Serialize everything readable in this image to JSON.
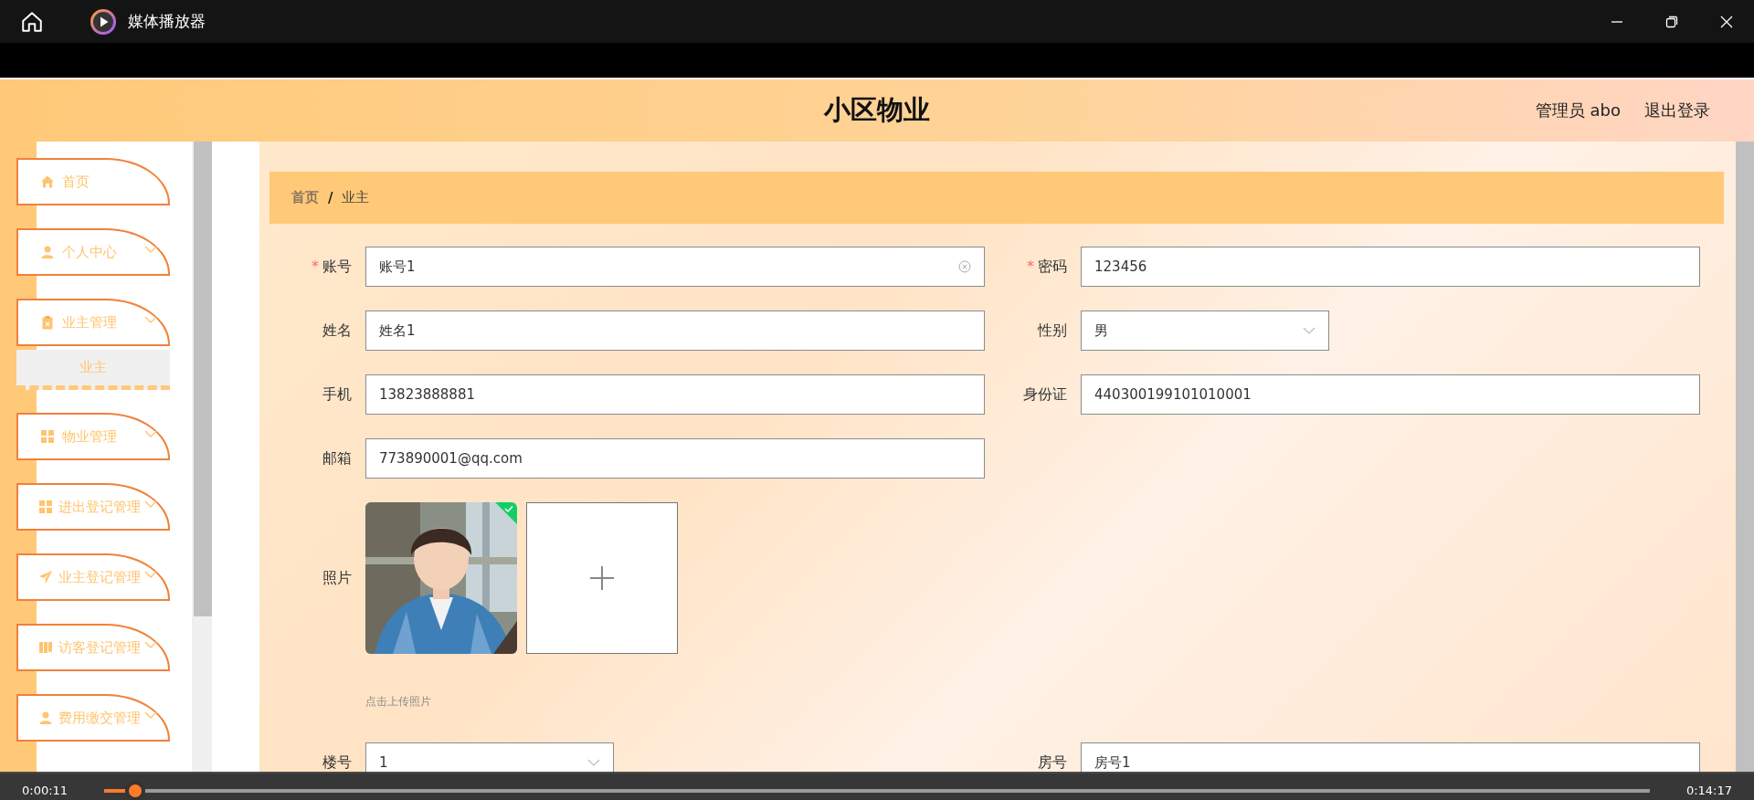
{
  "window": {
    "title": "媒体播放器"
  },
  "app": {
    "title": "小区物业",
    "user": "管理员 abo",
    "logout": "退出登录",
    "sidebar": [
      {
        "label": "首页",
        "has_submenu": false
      },
      {
        "label": "个人中心",
        "has_submenu": true
      },
      {
        "label": "业主管理",
        "has_submenu": true,
        "children": [
          {
            "label": "业主",
            "selected": true
          }
        ]
      },
      {
        "label": "物业管理",
        "has_submenu": true
      },
      {
        "label": "进出登记管理",
        "has_submenu": true
      },
      {
        "label": "业主登记管理",
        "has_submenu": true
      },
      {
        "label": "访客登记管理",
        "has_submenu": true
      },
      {
        "label": "费用缴交管理",
        "has_submenu": true
      }
    ],
    "breadcrumb": {
      "items": [
        "首页",
        "业主"
      ],
      "separator": "/"
    },
    "form": {
      "required_mark": "*",
      "rows": [
        [
          {
            "label": "账号",
            "required": true,
            "kind": "text",
            "value": "账号1",
            "focused": true
          },
          {
            "label": "密码",
            "required": true,
            "kind": "text",
            "value": "123456",
            "focused": false
          }
        ],
        [
          {
            "label": "姓名",
            "required": false,
            "kind": "text",
            "value": "姓名1",
            "focused": false
          },
          {
            "label": "性别",
            "required": false,
            "kind": "select",
            "value": "男"
          }
        ],
        [
          {
            "label": "手机",
            "required": false,
            "kind": "text",
            "value": "13823888881",
            "focused": false
          },
          {
            "label": "身份证",
            "required": false,
            "kind": "text",
            "value": "440300199101010001",
            "focused": false
          }
        ],
        [
          {
            "label": "邮箱",
            "required": false,
            "kind": "text",
            "value": "773890001@qq.com",
            "focused": false
          }
        ],
        [
          {
            "label": "照片",
            "required": false,
            "kind": "upload",
            "uploaded": true,
            "hint": "点击上传照片"
          }
        ],
        [
          {
            "label": "楼号",
            "required": false,
            "kind": "select",
            "value": "1"
          },
          {
            "label": "房号",
            "required": false,
            "kind": "text",
            "value": "房号1",
            "focused": false
          }
        ]
      ]
    }
  },
  "player": {
    "elapsed": "0:00:11",
    "duration": "0:14:17",
    "progress": {
      "level": 0.02
    }
  }
}
